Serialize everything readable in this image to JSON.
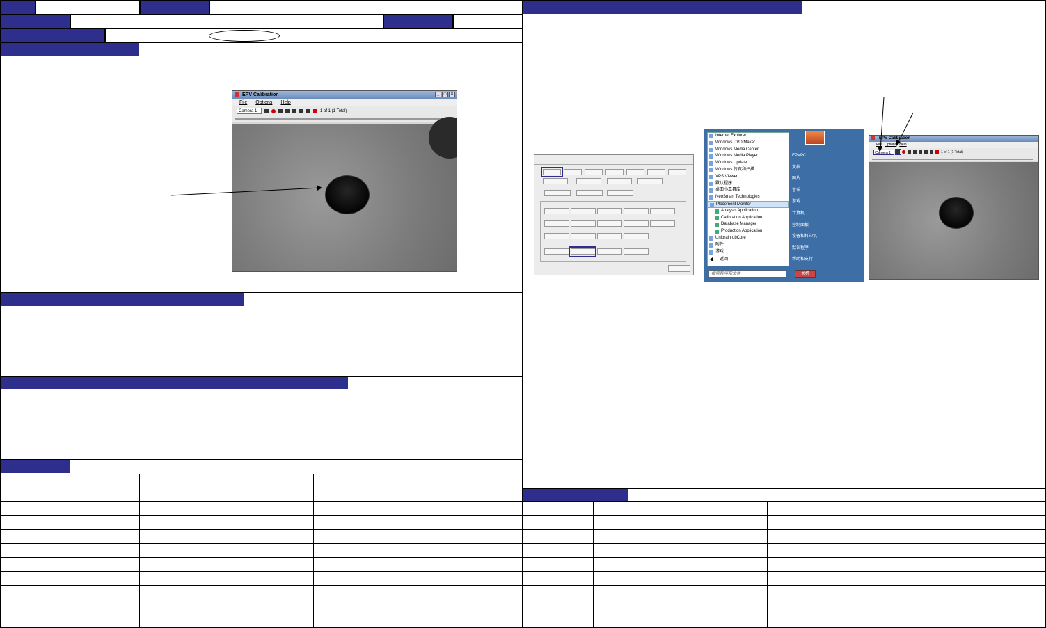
{
  "left_window": {
    "title": "EPV Calibration",
    "menu": [
      "File",
      "Options",
      "Help"
    ],
    "camera_select": "Camera 1",
    "frame_counter": "1 of 1 (1 Total)",
    "title_buttons": [
      "_",
      "□",
      "×"
    ]
  },
  "start_menu": {
    "programs": [
      {
        "label": "Internet Explorer",
        "sub": false,
        "selected": false
      },
      {
        "label": "Windows DVD Maker",
        "sub": false,
        "selected": false
      },
      {
        "label": "Windows Media Center",
        "sub": false,
        "selected": false
      },
      {
        "label": "Windows Media Player",
        "sub": false,
        "selected": false
      },
      {
        "label": "Windows Update",
        "sub": false,
        "selected": false
      },
      {
        "label": "Windows 传真和扫描",
        "sub": false,
        "selected": false
      },
      {
        "label": "XPS Viewer",
        "sub": false,
        "selected": false
      },
      {
        "label": "默认程序",
        "sub": false,
        "selected": false
      },
      {
        "label": "桌面小工具库",
        "sub": false,
        "selected": false
      },
      {
        "label": "NeoSmart Technologies",
        "sub": false,
        "selected": false
      },
      {
        "label": "Placement Monitor",
        "sub": false,
        "selected": true
      },
      {
        "label": "Analysis Application",
        "sub": true,
        "selected": false
      },
      {
        "label": "Calibration Application",
        "sub": true,
        "selected": false
      },
      {
        "label": "Database Manager",
        "sub": true,
        "selected": false
      },
      {
        "label": "Production Application",
        "sub": true,
        "selected": false
      },
      {
        "label": "Unibrain ubCore",
        "sub": false,
        "selected": false
      },
      {
        "label": "附件",
        "sub": false,
        "selected": false
      },
      {
        "label": "游戏",
        "sub": false,
        "selected": false
      }
    ],
    "back_label": "返回",
    "search_placeholder": "搜索程序和文件",
    "right_items": [
      "EPVPC",
      "文档",
      "图片",
      "音乐",
      "游戏",
      "计算机",
      "控制面板",
      "设备和打印机",
      "默认程序",
      "帮助和支持"
    ],
    "shutdown_label": "关机"
  },
  "right_window": {
    "title": "EPV Calibration",
    "menu": [
      "File",
      "Options",
      "Help"
    ],
    "camera_select": "Camera 1",
    "frame_counter": "1 of 1 (1 Total)"
  },
  "colors": {
    "header_blue": "#2e2e8c",
    "border": "#000000"
  }
}
